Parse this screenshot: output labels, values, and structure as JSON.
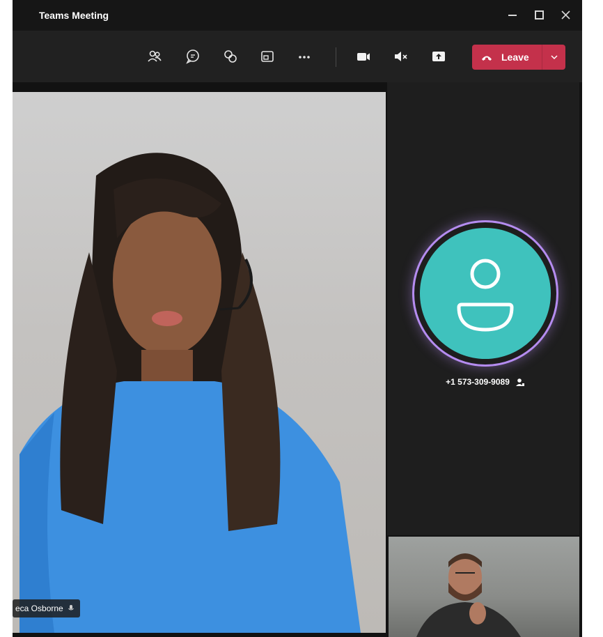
{
  "window": {
    "title": "Teams Meeting"
  },
  "toolbar": {
    "icons": [
      "participants-icon",
      "chat-icon",
      "reactions-icon",
      "share-tray-icon",
      "more-options-icon",
      "camera-icon",
      "mute-icon",
      "share-screen-icon"
    ],
    "leave_label": "Leave"
  },
  "main_participant": {
    "name": "eca Osborne"
  },
  "caller": {
    "phone": "+1 573-309-9089"
  },
  "colors": {
    "leave": "#c4314b",
    "avatar": "#3fc2bd",
    "avatar_ring": "#b58cf0"
  }
}
